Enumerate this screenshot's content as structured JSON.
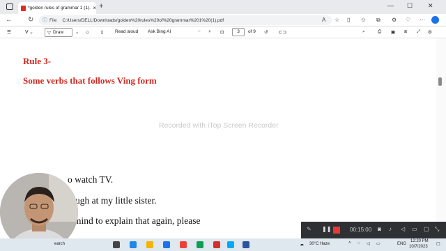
{
  "browser": {
    "tab_title": "*golden rules of grammar 1 (1).p",
    "tab_close": "×",
    "new_tab": "+",
    "win_minimize": "—",
    "win_maximize": "☐",
    "win_close": "✕",
    "address_prefix": "File",
    "url": "C:/Users/DELL/Downloads/golden%20rules%20of%20grammar%201%20(1).pdf"
  },
  "pdf_toolbar": {
    "draw_label": "Draw",
    "read_aloud_label": "Read aloud",
    "ask_bing_label": "Ask Bing AI",
    "zoom_out": "−",
    "zoom_in": "+",
    "current_page": "3",
    "page_total": "of 9"
  },
  "document": {
    "heading": "Rule 3-",
    "subheading": "Some verbs that follows Ving form",
    "watermark": "Recorded with iTop Screen Recorder",
    "line1": "o watch TV.",
    "line2": "ugh at my little sister.",
    "line3": "mind to explain that again, please"
  },
  "recorder": {
    "timer": "00:15:00"
  },
  "taskbar": {
    "search_label": "earch",
    "weather": "30°C  Haze",
    "language": "ENG",
    "time": "12:20 PM",
    "date": "10/7/2023"
  }
}
